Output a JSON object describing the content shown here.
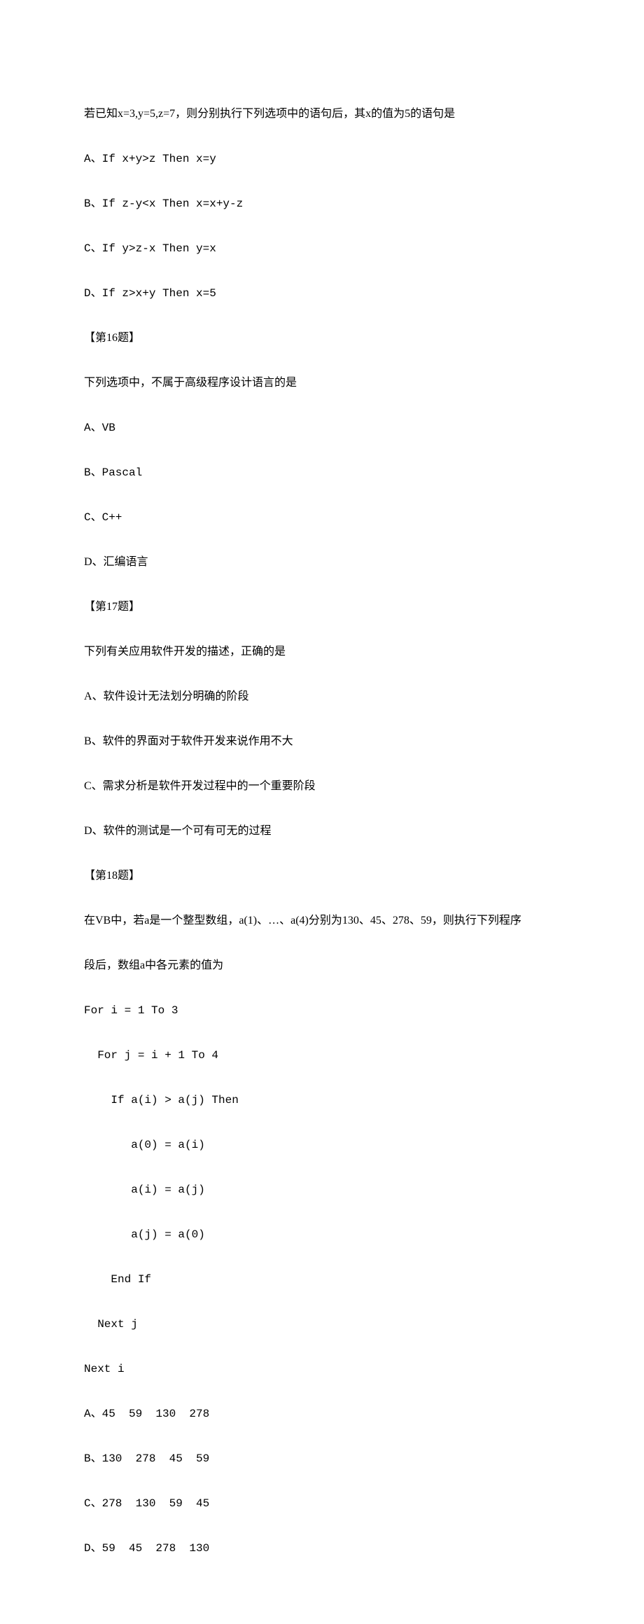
{
  "q15": {
    "stem": "若已知x=3,y=5,z=7，则分别执行下列选项中的语句后，其x的值为5的语句是",
    "A": "A、If x+y>z Then x=y",
    "B": "B、If z-y<x Then x=x+y-z",
    "C": "C、If y>z-x Then y=x",
    "D": "D、If z>x+y Then x=5"
  },
  "q16": {
    "header": "【第16题】",
    "stem": "下列选项中，不属于高级程序设计语言的是",
    "A": "A、VB",
    "B": "B、Pascal",
    "C": "C、C++",
    "D": "D、汇编语言"
  },
  "q17": {
    "header": "【第17题】",
    "stem": "下列有关应用软件开发的描述，正确的是",
    "A": "A、软件设计无法划分明确的阶段",
    "B": "B、软件的界面对于软件开发来说作用不大",
    "C": "C、需求分析是软件开发过程中的一个重要阶段",
    "D": "D、软件的测试是一个可有可无的过程"
  },
  "q18": {
    "header": "【第18题】",
    "stem1": "在VB中，若a是一个整型数组，a(1)、…、a(4)分别为130、45、278、59，则执行下列程序",
    "stem2": "段后，数组a中各元素的值为",
    "code": {
      "l1": "For i = 1 To 3",
      "l2": "  For j = i + 1 To 4",
      "l3": "    If a(i) > a(j) Then",
      "l4": "       a(0) = a(i)",
      "l5": "       a(i) = a(j)",
      "l6": "       a(j) = a(0)",
      "l7": "    End If",
      "l8": "  Next j",
      "l9": "Next i"
    },
    "A": "A、45  59  130  278",
    "B": "B、130  278  45  59",
    "C": "C、278  130  59  45",
    "D": "D、59  45  278  130"
  }
}
